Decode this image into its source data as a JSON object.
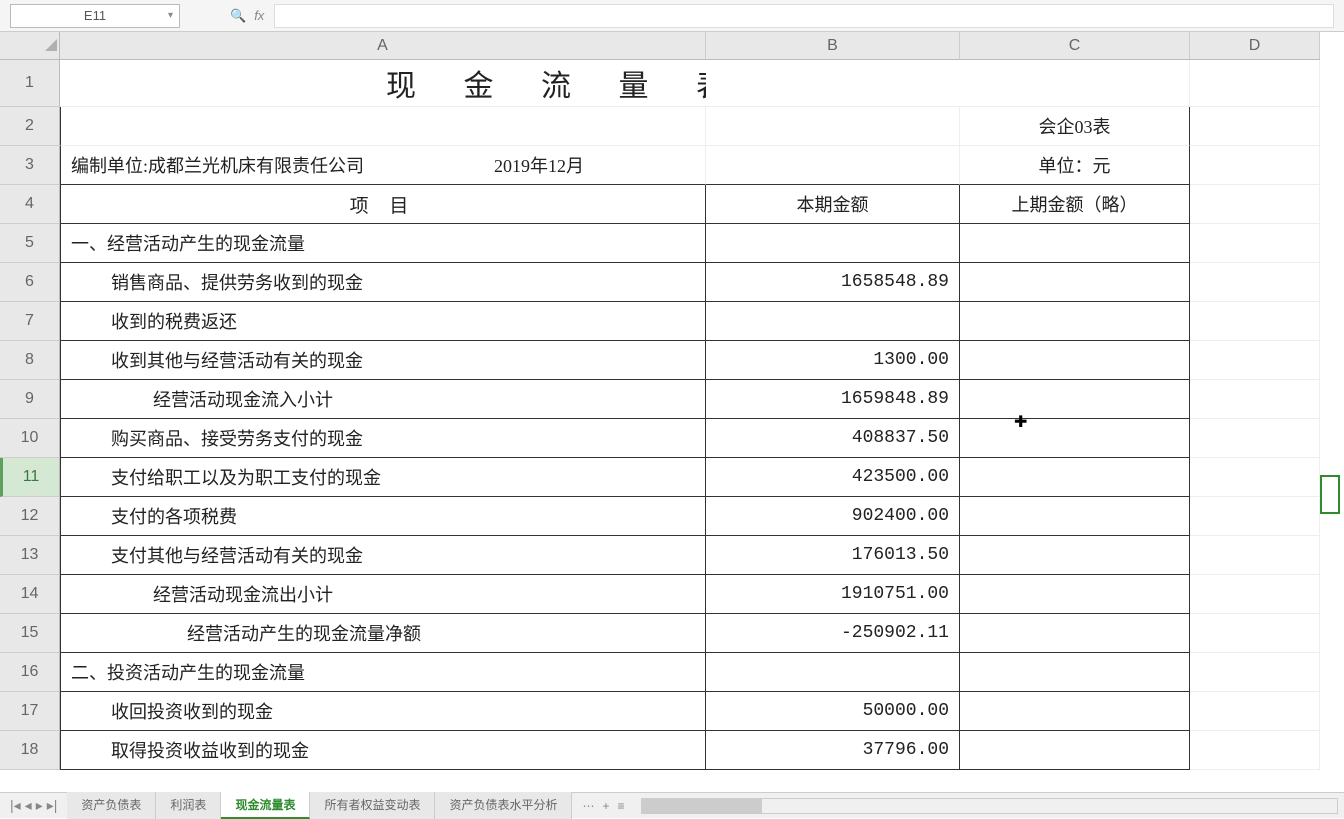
{
  "name_box": "E11",
  "fx_label": "fx",
  "title": "现 金 流 量 表",
  "form_code": "会企03表",
  "company_label": "编制单位:成都兰光机床有限责任公司",
  "period": "2019年12月",
  "unit": "单位：元",
  "col_headers": {
    "A": "A",
    "B": "B",
    "C": "C",
    "D": "D"
  },
  "row_headers": [
    "1",
    "2",
    "3",
    "4",
    "5",
    "6",
    "7",
    "8",
    "9",
    "10",
    "11",
    "12",
    "13",
    "14",
    "15",
    "16",
    "17",
    "18"
  ],
  "headers": {
    "item": "项    目",
    "amount": "本期金额",
    "prev": "上期金额（略）"
  },
  "rows": [
    {
      "label": "一、经营活动产生的现金流量",
      "val": "",
      "indent": 0
    },
    {
      "label": "销售商品、提供劳务收到的现金",
      "val": "1658548.89",
      "indent": 1
    },
    {
      "label": "收到的税费返还",
      "val": "",
      "indent": 1
    },
    {
      "label": "收到其他与经营活动有关的现金",
      "val": "1300.00",
      "indent": 1
    },
    {
      "label": "经营活动现金流入小计",
      "val": "1659848.89",
      "indent": 2
    },
    {
      "label": "购买商品、接受劳务支付的现金",
      "val": "408837.50",
      "indent": 1
    },
    {
      "label": "支付给职工以及为职工支付的现金",
      "val": "423500.00",
      "indent": 1
    },
    {
      "label": "支付的各项税费",
      "val": "902400.00",
      "indent": 1
    },
    {
      "label": "支付其他与经营活动有关的现金",
      "val": "176013.50",
      "indent": 1
    },
    {
      "label": "经营活动现金流出小计",
      "val": "1910751.00",
      "indent": 2
    },
    {
      "label": "经营活动产生的现金流量净额",
      "val": "-250902.11",
      "indent": 3
    },
    {
      "label": "二、投资活动产生的现金流量",
      "val": "",
      "indent": 0
    },
    {
      "label": "收回投资收到的现金",
      "val": "50000.00",
      "indent": 1
    },
    {
      "label": "取得投资收益收到的现金",
      "val": "37796.00",
      "indent": 1
    }
  ],
  "tabs": [
    "资产负债表",
    "利润表",
    "现金流量表",
    "所有者权益变动表",
    "资产负债表水平分析"
  ],
  "active_tab": 2
}
